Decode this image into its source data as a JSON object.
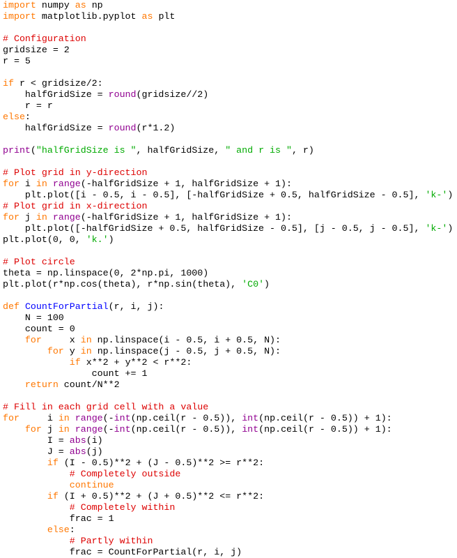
{
  "editor": {
    "colors": {
      "keyword": "#ff7700",
      "builtin": "#900090",
      "comment": "#dd0000",
      "string": "#00aa00",
      "definition": "#0000ff",
      "text": "#000000",
      "background": "#ffffff"
    },
    "lines": [
      [
        [
          "kw",
          "import"
        ],
        [
          "tx",
          " numpy "
        ],
        [
          "kw",
          "as"
        ],
        [
          "tx",
          " np"
        ]
      ],
      [
        [
          "kw",
          "import"
        ],
        [
          "tx",
          " matplotlib.pyplot "
        ],
        [
          "kw",
          "as"
        ],
        [
          "tx",
          " plt"
        ]
      ],
      [],
      [
        [
          "cm",
          "# Configuration"
        ]
      ],
      [
        [
          "tx",
          "gridsize = 2"
        ]
      ],
      [
        [
          "tx",
          "r = 5"
        ]
      ],
      [],
      [
        [
          "kw",
          "if"
        ],
        [
          "tx",
          " r < gridsize/2:"
        ]
      ],
      [
        [
          "tx",
          "    halfGridSize = "
        ],
        [
          "bi",
          "round"
        ],
        [
          "tx",
          "(gridsize//2)"
        ]
      ],
      [
        [
          "tx",
          "    r = r"
        ]
      ],
      [
        [
          "kw",
          "else"
        ],
        [
          "tx",
          ":"
        ]
      ],
      [
        [
          "tx",
          "    halfGridSize = "
        ],
        [
          "bi",
          "round"
        ],
        [
          "tx",
          "(r*1.2)"
        ]
      ],
      [],
      [
        [
          "bi",
          "print"
        ],
        [
          "tx",
          "("
        ],
        [
          "st",
          "\"halfGridSize is \""
        ],
        [
          "tx",
          ", halfGridSize, "
        ],
        [
          "st",
          "\" and r is \""
        ],
        [
          "tx",
          ", r)"
        ]
      ],
      [],
      [
        [
          "cm",
          "# Plot grid in y-direction"
        ]
      ],
      [
        [
          "kw",
          "for"
        ],
        [
          "tx",
          " i "
        ],
        [
          "kw",
          "in"
        ],
        [
          "tx",
          " "
        ],
        [
          "bi",
          "range"
        ],
        [
          "tx",
          "(-halfGridSize + 1, halfGridSize + 1):"
        ]
      ],
      [
        [
          "tx",
          "    plt.plot([i - 0.5, i - 0.5], [-halfGridSize + 0.5, halfGridSize - 0.5], "
        ],
        [
          "st",
          "'k-'"
        ],
        [
          "tx",
          ")"
        ]
      ],
      [
        [
          "cm",
          "# Plot grid in x-direction"
        ]
      ],
      [
        [
          "kw",
          "for"
        ],
        [
          "tx",
          " j "
        ],
        [
          "kw",
          "in"
        ],
        [
          "tx",
          " "
        ],
        [
          "bi",
          "range"
        ],
        [
          "tx",
          "(-halfGridSize + 1, halfGridSize + 1):"
        ]
      ],
      [
        [
          "tx",
          "    plt.plot([-halfGridSize + 0.5, halfGridSize - 0.5], [j - 0.5, j - 0.5], "
        ],
        [
          "st",
          "'k-'"
        ],
        [
          "tx",
          ")"
        ]
      ],
      [
        [
          "tx",
          "plt.plot(0, 0, "
        ],
        [
          "st",
          "'k.'"
        ],
        [
          "tx",
          ")"
        ]
      ],
      [],
      [
        [
          "cm",
          "# Plot circle"
        ]
      ],
      [
        [
          "tx",
          "theta = np.linspace(0, 2*np.pi, 1000)"
        ]
      ],
      [
        [
          "tx",
          "plt.plot(r*np.cos(theta), r*np.sin(theta), "
        ],
        [
          "st",
          "'C0'"
        ],
        [
          "tx",
          ")"
        ]
      ],
      [],
      [
        [
          "kw",
          "def"
        ],
        [
          "tx",
          " "
        ],
        [
          "df",
          "CountForPartial"
        ],
        [
          "tx",
          "(r, i, j):"
        ]
      ],
      [
        [
          "tx",
          "    N = 100"
        ]
      ],
      [
        [
          "tx",
          "    count = 0"
        ]
      ],
      [
        [
          "tx",
          "    "
        ],
        [
          "kw",
          "for"
        ],
        [
          "tx",
          "     x "
        ],
        [
          "kw",
          "in"
        ],
        [
          "tx",
          " np.linspace(i - 0.5, i + 0.5, N):"
        ]
      ],
      [
        [
          "tx",
          "        "
        ],
        [
          "kw",
          "for"
        ],
        [
          "tx",
          " y "
        ],
        [
          "kw",
          "in"
        ],
        [
          "tx",
          " np.linspace(j - 0.5, j + 0.5, N):"
        ]
      ],
      [
        [
          "tx",
          "            "
        ],
        [
          "kw",
          "if"
        ],
        [
          "tx",
          " x**2 + y**2 < r**2:"
        ]
      ],
      [
        [
          "tx",
          "                count += 1"
        ]
      ],
      [
        [
          "tx",
          "    "
        ],
        [
          "kw",
          "return"
        ],
        [
          "tx",
          " count/N**2"
        ]
      ],
      [],
      [
        [
          "cm",
          "# Fill in each grid cell with a value"
        ]
      ],
      [
        [
          "kw",
          "for"
        ],
        [
          "tx",
          "     i "
        ],
        [
          "kw",
          "in"
        ],
        [
          "tx",
          " "
        ],
        [
          "bi",
          "range"
        ],
        [
          "tx",
          "(-"
        ],
        [
          "bi",
          "int"
        ],
        [
          "tx",
          "(np.ceil(r - 0.5)), "
        ],
        [
          "bi",
          "int"
        ],
        [
          "tx",
          "(np.ceil(r - 0.5)) + 1):"
        ]
      ],
      [
        [
          "tx",
          "    "
        ],
        [
          "kw",
          "for"
        ],
        [
          "tx",
          " j "
        ],
        [
          "kw",
          "in"
        ],
        [
          "tx",
          " "
        ],
        [
          "bi",
          "range"
        ],
        [
          "tx",
          "(-"
        ],
        [
          "bi",
          "int"
        ],
        [
          "tx",
          "(np.ceil(r - 0.5)), "
        ],
        [
          "bi",
          "int"
        ],
        [
          "tx",
          "(np.ceil(r - 0.5)) + 1):"
        ]
      ],
      [
        [
          "tx",
          "        I = "
        ],
        [
          "bi",
          "abs"
        ],
        [
          "tx",
          "(i)"
        ]
      ],
      [
        [
          "tx",
          "        J = "
        ],
        [
          "bi",
          "abs"
        ],
        [
          "tx",
          "(j)"
        ]
      ],
      [
        [
          "tx",
          "        "
        ],
        [
          "kw",
          "if"
        ],
        [
          "tx",
          " (I - 0.5)**2 + (J - 0.5)**2 >= r**2:"
        ]
      ],
      [
        [
          "tx",
          "            "
        ],
        [
          "cm",
          "# Completely outside"
        ]
      ],
      [
        [
          "tx",
          "            "
        ],
        [
          "kw",
          "continue"
        ]
      ],
      [
        [
          "tx",
          "        "
        ],
        [
          "kw",
          "if"
        ],
        [
          "tx",
          " (I + 0.5)**2 + (J + 0.5)**2 <= r**2:"
        ]
      ],
      [
        [
          "tx",
          "            "
        ],
        [
          "cm",
          "# Completely within"
        ]
      ],
      [
        [
          "tx",
          "            frac = 1"
        ]
      ],
      [
        [
          "tx",
          "        "
        ],
        [
          "kw",
          "else"
        ],
        [
          "tx",
          ":"
        ]
      ],
      [
        [
          "tx",
          "            "
        ],
        [
          "cm",
          "# Partly within"
        ]
      ],
      [
        [
          "tx",
          "            frac = CountForPartial(r, i, j)"
        ]
      ]
    ]
  }
}
